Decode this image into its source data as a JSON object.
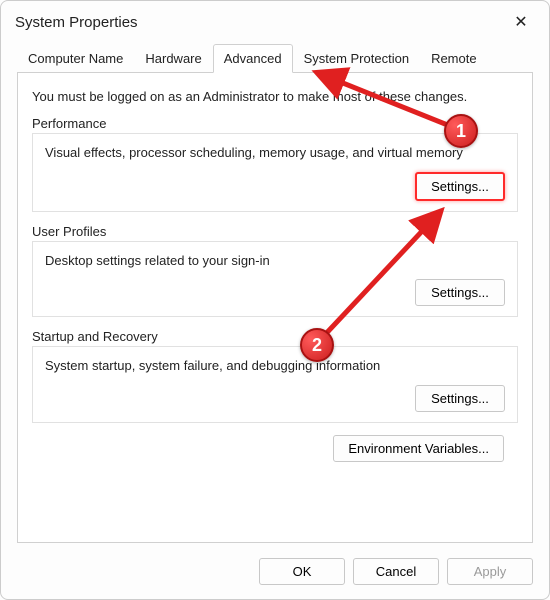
{
  "window": {
    "title": "System Properties",
    "close_glyph": "✕"
  },
  "tabs": [
    {
      "label": "Computer Name",
      "active": false
    },
    {
      "label": "Hardware",
      "active": false
    },
    {
      "label": "Advanced",
      "active": true
    },
    {
      "label": "System Protection",
      "active": false
    },
    {
      "label": "Remote",
      "active": false
    }
  ],
  "advanced": {
    "intro": "You must be logged on as an Administrator to make most of these changes.",
    "performance": {
      "title": "Performance",
      "desc": "Visual effects, processor scheduling, memory usage, and virtual memory",
      "button": "Settings..."
    },
    "user_profiles": {
      "title": "User Profiles",
      "desc": "Desktop settings related to your sign-in",
      "button": "Settings..."
    },
    "startup_recovery": {
      "title": "Startup and Recovery",
      "desc": "System startup, system failure, and debugging information",
      "button": "Settings..."
    },
    "env_vars_button": "Environment Variables..."
  },
  "footer": {
    "ok": "OK",
    "cancel": "Cancel",
    "apply": "Apply"
  },
  "annotations": {
    "marker1": "1",
    "marker2": "2",
    "accent_color": "#ff2a2a"
  }
}
